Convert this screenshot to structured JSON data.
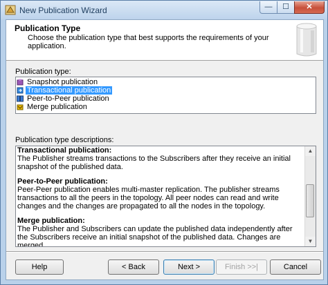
{
  "window": {
    "title": "New Publication Wizard",
    "close_glyph": "✕",
    "min_glyph": "—",
    "max_glyph": "☐"
  },
  "header": {
    "title": "Publication Type",
    "description": "Choose the publication type that best supports the requirements of your application."
  },
  "publication_types": {
    "label": "Publication type:",
    "items": [
      {
        "label": "Snapshot publication",
        "selected": false
      },
      {
        "label": "Transactional publication",
        "selected": true
      },
      {
        "label": "Peer-to-Peer publication",
        "selected": false
      },
      {
        "label": "Merge publication",
        "selected": false
      }
    ]
  },
  "descriptions": {
    "label": "Publication type descriptions:",
    "sections": [
      {
        "heading": "Transactional publication:",
        "body": "The Publisher streams transactions to the Subscribers after they receive an initial snapshot of the published data."
      },
      {
        "heading": "Peer-to-Peer publication:",
        "body": "Peer-Peer publication enables multi-master replication. The publisher streams transactions to all the peers in the topology. All peer nodes can read and write changes and the changes are propagated to all the nodes in the topology."
      },
      {
        "heading": "Merge publication:",
        "body": "The Publisher and Subscribers can update the published data independently after the Subscribers receive an initial snapshot of the published data. Changes are merged"
      }
    ]
  },
  "buttons": {
    "help": "Help",
    "back": "< Back",
    "next": "Next >",
    "finish": "Finish >>|",
    "cancel": "Cancel"
  }
}
